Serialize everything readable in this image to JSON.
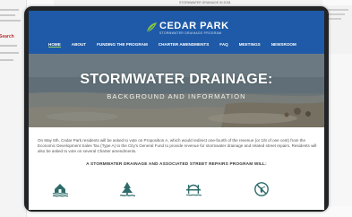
{
  "logo": {
    "name": "CEDAR PARK",
    "subtitle": "STORMWATER DRAINAGE PROGRAM"
  },
  "nav": [
    {
      "label": "HOME",
      "active": true
    },
    {
      "label": "ABOUT",
      "active": false
    },
    {
      "label": "FUNDING THE PROGRAM",
      "active": false
    },
    {
      "label": "CHARTER AMENDMENTS",
      "active": false
    },
    {
      "label": "FAQ",
      "active": false
    },
    {
      "label": "MEETINGS",
      "active": false
    },
    {
      "label": "NEWSROOM",
      "active": false
    }
  ],
  "hero": {
    "title": "STORMWATER DRAINAGE:",
    "subtitle": "BACKGROUND AND INFORMATION"
  },
  "intro": "On May 5th, Cedar Park residents will be asked to vote on Proposition A, which would redirect one-fourth of the revenue (or 1/8 of one cent) from the Economic Development Sales Tax (Type A) to the City's General Fund to provide revenue for stormwater drainage and related street repairs. Residents will also be asked to vote on several Charter amendments.",
  "program_heading": "A STORMWATER DRAINAGE AND ASSOCIATED STREET REPAIRS PROGRAM WILL:",
  "program_icons": [
    "flooded-house-icon",
    "rising-water-tree-icon",
    "bridge-icon",
    "no-mosquito-icon"
  ],
  "background_paper_top": "STORMWATER DRAINAGE IN 2018",
  "colors": {
    "brand_blue": "#1e5aa8",
    "accent_green": "#8cc63f",
    "icon_teal": "#2f6b6b",
    "bezel": "#222426"
  }
}
